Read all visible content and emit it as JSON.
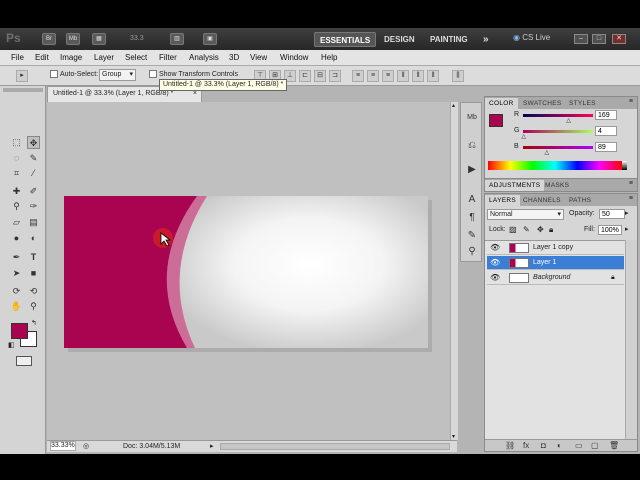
{
  "appbar": {
    "logo": "Ps",
    "zoom": "33.3",
    "workspaces": [
      "ESSENTIALS",
      "DESIGN",
      "PAINTING"
    ],
    "more": "»",
    "cs_live": "CS Live"
  },
  "menus": [
    "File",
    "Edit",
    "Image",
    "Layer",
    "Select",
    "Filter",
    "Analysis",
    "3D",
    "View",
    "Window",
    "Help"
  ],
  "options": {
    "auto_select_label": "Auto-Select:",
    "auto_select_value": "Group",
    "show_transform_label": "Show Transform Controls"
  },
  "document": {
    "tab_title": "Untitled-1 @ 33.3% (Layer 1, RGB/8) *",
    "tooltip": "Untitled-1 @ 33.3% (Layer 1, RGB/8) *",
    "zoom_status": "33.33%",
    "doc_size": "Doc: 3.04M/5.13M"
  },
  "colors": {
    "foreground": "#a9044f",
    "background": "#ffffff"
  },
  "color_panel": {
    "tabs": [
      "COLOR",
      "SWATCHES",
      "STYLES"
    ],
    "r_label": "R",
    "g_label": "G",
    "b_label": "B",
    "r": "169",
    "g": "4",
    "b": "89",
    "r_frac": 0.66,
    "g_frac": 0.02,
    "b_frac": 0.35
  },
  "adjustments_panel": {
    "tabs": [
      "ADJUSTMENTS",
      "MASKS"
    ]
  },
  "layers_panel": {
    "tabs": [
      "LAYERS",
      "CHANNELS",
      "PATHS"
    ],
    "blend_mode": "Normal",
    "opacity_label": "Opacity:",
    "opacity_value": "50",
    "lock_label": "Lock:",
    "fill_label": "Fill:",
    "fill_value": "100%",
    "layers": [
      {
        "name": "Layer 1 copy"
      },
      {
        "name": "Layer 1"
      },
      {
        "name": "Background"
      }
    ]
  }
}
